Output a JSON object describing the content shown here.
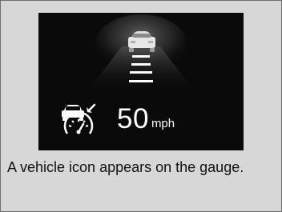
{
  "display": {
    "speed_value": "50",
    "speed_unit": "mph",
    "icons": [
      "preceding-vehicle-icon",
      "lane-lines-icon",
      "adaptive-cruise-control-icon"
    ],
    "background_color": "#0a0a0a",
    "text_color": "#ffffff"
  },
  "caption": {
    "text": "A vehicle icon appears on the gauge."
  }
}
